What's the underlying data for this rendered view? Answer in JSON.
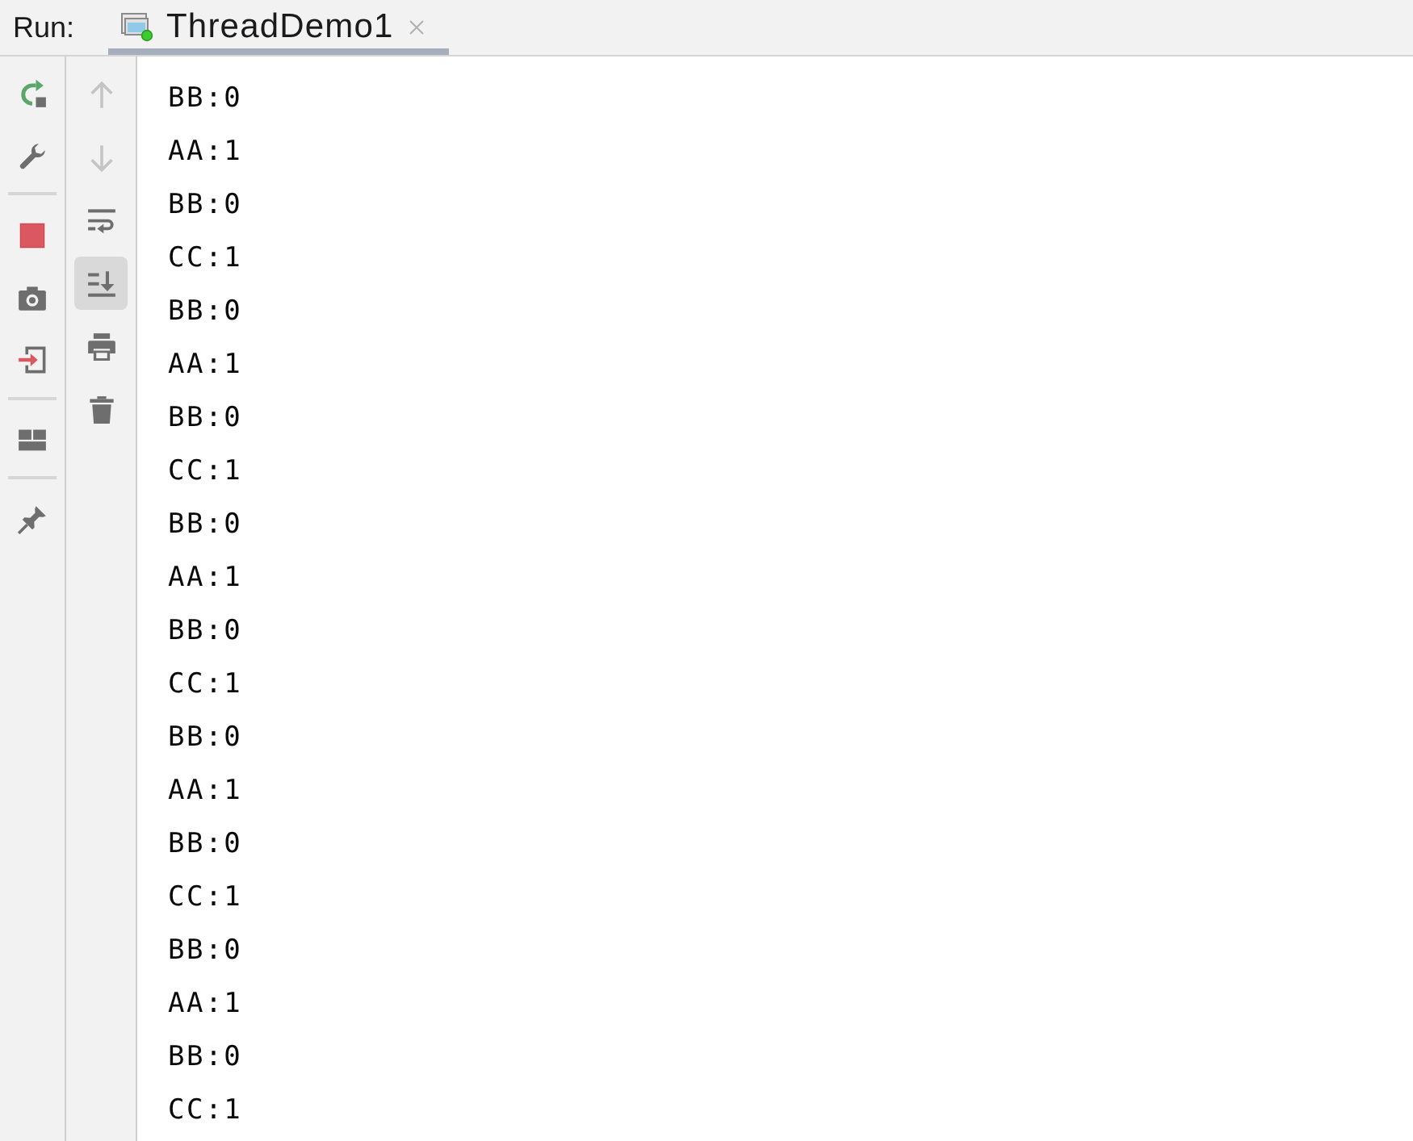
{
  "run_panel": {
    "label": "Run:",
    "tabs": [
      {
        "label": "ThreadDemo1",
        "selected": true,
        "running": true
      }
    ]
  },
  "console_toolbar": [
    {
      "disabled": true,
      "on": false
    },
    {
      "disabled": true,
      "on": false
    },
    {
      "disabled": false,
      "on": false
    },
    {
      "disabled": false,
      "on": true
    },
    {
      "disabled": false,
      "on": false
    },
    {
      "disabled": false,
      "on": false
    }
  ],
  "console": {
    "lines": [
      "BB:0",
      "AA:1",
      "BB:0",
      "CC:1",
      "BB:0",
      "AA:1",
      "BB:0",
      "CC:1",
      "BB:0",
      "AA:1",
      "BB:0",
      "CC:1",
      "BB:0",
      "AA:1",
      "BB:0",
      "CC:1",
      "BB:0",
      "AA:1",
      "BB:0",
      "CC:1"
    ]
  }
}
